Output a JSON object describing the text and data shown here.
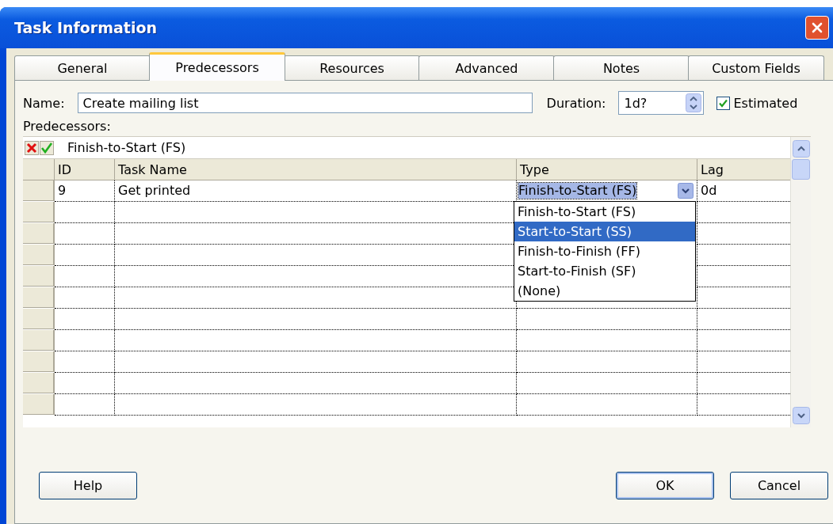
{
  "window": {
    "title": "Task Information"
  },
  "tabs": [
    {
      "label": "General",
      "selected": false
    },
    {
      "label": "Predecessors",
      "selected": true
    },
    {
      "label": "Resources",
      "selected": false
    },
    {
      "label": "Advanced",
      "selected": false
    },
    {
      "label": "Notes",
      "selected": false
    },
    {
      "label": "Custom Fields",
      "selected": false
    }
  ],
  "name_field": {
    "label": "Name:",
    "value": "Create mailing list"
  },
  "duration_field": {
    "label": "Duration:",
    "value": "1d?"
  },
  "estimated": {
    "label": "Estimated",
    "checked": true
  },
  "predecessors": {
    "label": "Predecessors:",
    "entry_value": "Finish-to-Start (FS)",
    "columns": [
      "ID",
      "Task Name",
      "Type",
      "Lag"
    ],
    "rows": [
      {
        "id": "9",
        "task_name": "Get printed",
        "type": "Finish-to-Start (FS)",
        "lag": "0d"
      }
    ],
    "type_options": [
      {
        "label": "Finish-to-Start (FS)",
        "selected": false
      },
      {
        "label": "Start-to-Start (SS)",
        "selected": true
      },
      {
        "label": "Finish-to-Finish (FF)",
        "selected": false
      },
      {
        "label": "Start-to-Finish (SF)",
        "selected": false
      },
      {
        "label": "(None)",
        "selected": false
      }
    ]
  },
  "buttons": {
    "help": "Help",
    "ok": "OK",
    "cancel": "Cancel"
  }
}
